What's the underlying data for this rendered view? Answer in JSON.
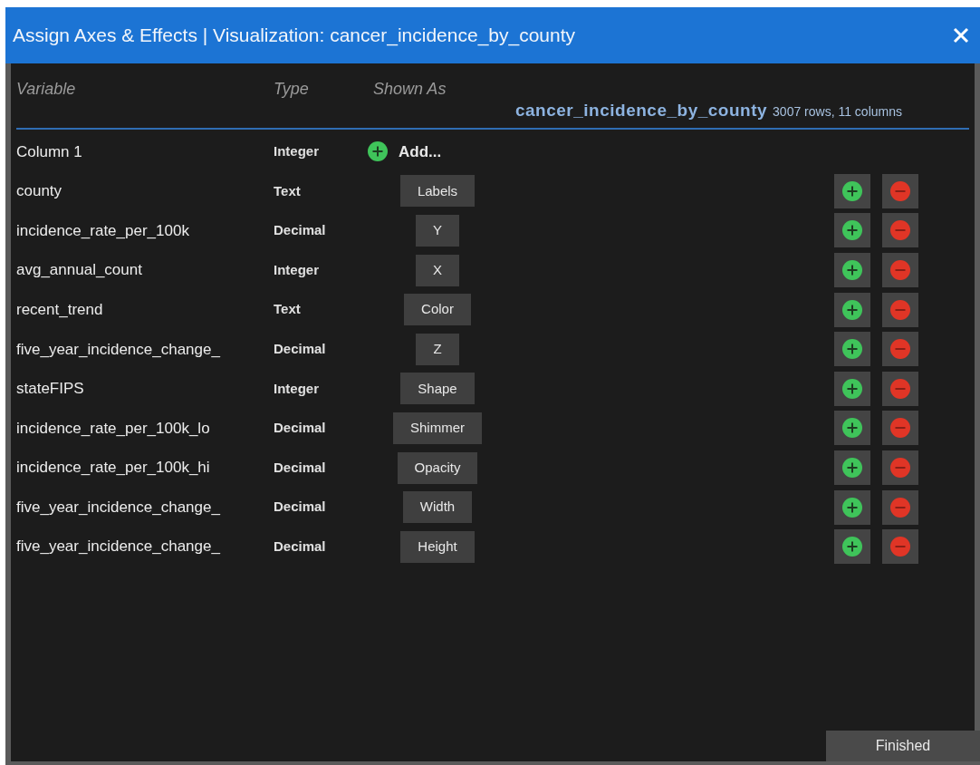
{
  "window": {
    "title": "Assign Axes & Effects | Visualization: cancer_incidence_by_county"
  },
  "columns": [
    "Variable",
    "Type",
    "Shown As"
  ],
  "dataset": {
    "name": "cancer_incidence_by_county",
    "summary": "3007 rows, 11 columns"
  },
  "rows": [
    {
      "variable": "Column 1",
      "type": "Integer",
      "kind": "add",
      "shown_as": "Add..."
    },
    {
      "variable": "county",
      "type": "Text",
      "kind": "assigned",
      "shown_as": "Labels"
    },
    {
      "variable": "incidence_rate_per_100k",
      "type": "Decimal",
      "kind": "assigned",
      "shown_as": "Y"
    },
    {
      "variable": "avg_annual_count",
      "type": "Integer",
      "kind": "assigned",
      "shown_as": "X"
    },
    {
      "variable": "recent_trend",
      "type": "Text",
      "kind": "assigned",
      "shown_as": "Color"
    },
    {
      "variable": "five_year_incidence_change_",
      "type": "Decimal",
      "kind": "assigned",
      "shown_as": "Z"
    },
    {
      "variable": "stateFIPS",
      "type": "Integer",
      "kind": "assigned",
      "shown_as": "Shape"
    },
    {
      "variable": "incidence_rate_per_100k_lo",
      "type": "Decimal",
      "kind": "assigned",
      "shown_as": "Shimmer"
    },
    {
      "variable": "incidence_rate_per_100k_hi",
      "type": "Decimal",
      "kind": "assigned",
      "shown_as": "Opacity"
    },
    {
      "variable": "five_year_incidence_change_",
      "type": "Decimal",
      "kind": "assigned",
      "shown_as": "Width"
    },
    {
      "variable": "five_year_incidence_change_",
      "type": "Decimal",
      "kind": "assigned",
      "shown_as": "Height"
    }
  ],
  "footer": {
    "button": "Finished"
  }
}
